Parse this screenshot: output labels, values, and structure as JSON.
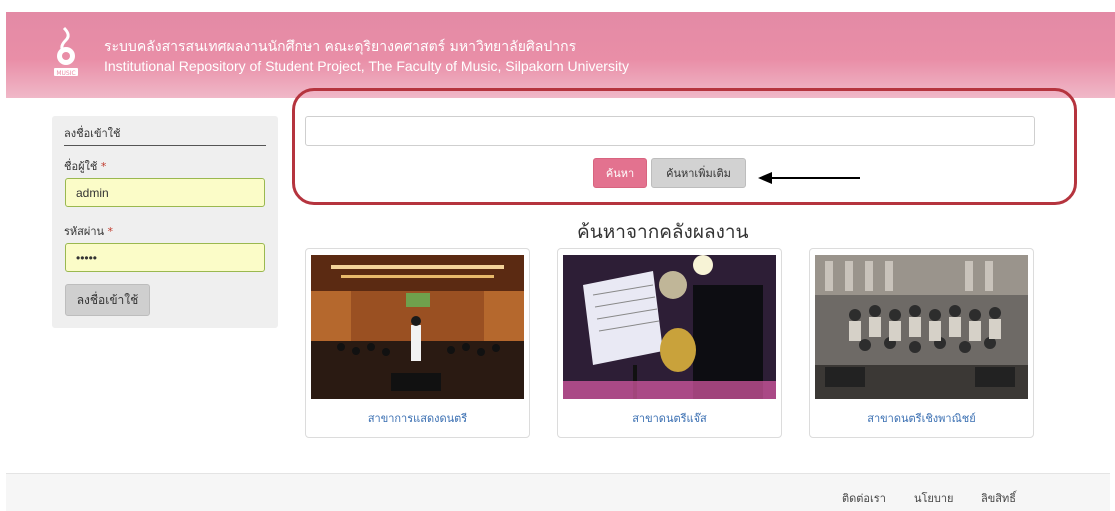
{
  "header": {
    "title_th": "ระบบคลังสารสนเทศผลงานนักศึกษา คณะดุริยางคศาสตร์ มหาวิทยาลัยศิลปากร",
    "title_en": "Institutional Repository of Student Project, The Faculty of Music, Silpakorn University",
    "logo_text": "MUSIC",
    "accent_color": "#e98ea7"
  },
  "login": {
    "title": "ลงชื่อเข้าใช้",
    "username_label": "ชื่อผู้ใช้",
    "username_value": "admin",
    "password_label": "รหัสผ่าน",
    "password_value": "•••••",
    "required_mark": "*",
    "submit_label": "ลงชื่อเข้าใช้"
  },
  "search": {
    "query": "",
    "search_label": "ค้นหา",
    "advanced_label": "ค้นหาเพิ่มเติม",
    "highlight_color": "#b5343e"
  },
  "collections": {
    "heading": "ค้นหาจากคลังผลงาน",
    "items": [
      {
        "label": "สาขาการแสดงดนตรี",
        "image": "concert-hall-orchestra"
      },
      {
        "label": "สาขาดนตรีแจ๊ส",
        "image": "jazz-saxophone-player"
      },
      {
        "label": "สาขาดนตรีเชิงพาณิชย์",
        "image": "studio-group-photo"
      }
    ]
  },
  "footer": {
    "contact": "ติดต่อเรา",
    "policy": "นโยบาย",
    "copyright": "ลิขสิทธิ์"
  }
}
